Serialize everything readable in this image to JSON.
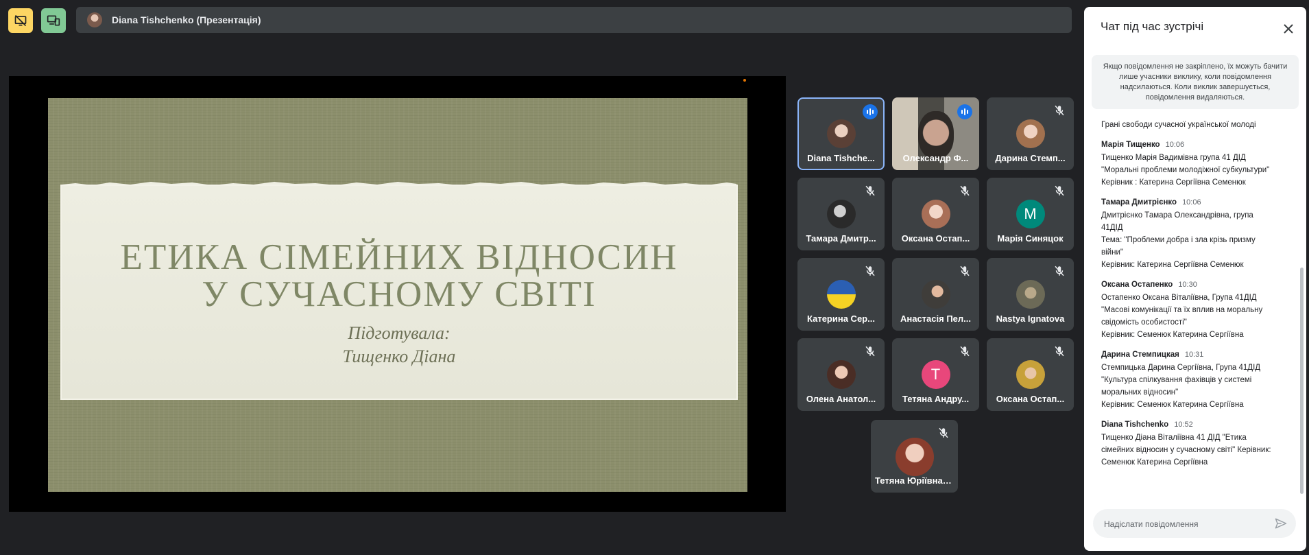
{
  "presenter": {
    "name": "Diana Tishchenko (Презентація)"
  },
  "slide": {
    "title_line1": "ЕТИКА СІМЕЙНИХ ВІДНОСИН",
    "title_line2": "У СУЧАСНОМУ СВІТІ",
    "subtitle_line1": "Підготувала:",
    "subtitle_line2": "Тищенко Діана"
  },
  "participants": [
    {
      "name": "Diana Tishche...",
      "state": "speaking",
      "avatar": "photo"
    },
    {
      "name": "Олександр Ф...",
      "state": "speaking",
      "avatar": "video"
    },
    {
      "name": "Дарина Стемп...",
      "state": "muted",
      "avatar": "photo"
    },
    {
      "name": "Тамара Дмитр...",
      "state": "muted",
      "avatar": "photo"
    },
    {
      "name": "Оксана Остап...",
      "state": "muted",
      "avatar": "photo"
    },
    {
      "name": "Марія Синяцок",
      "state": "muted",
      "avatar": "letter",
      "letter": "M",
      "color": "#00897b"
    },
    {
      "name": "Катерина Сер...",
      "state": "muted",
      "avatar": "photo"
    },
    {
      "name": "Анастасія Пел...",
      "state": "muted",
      "avatar": "photo"
    },
    {
      "name": "Nastya Ignatova",
      "state": "muted",
      "avatar": "photo"
    },
    {
      "name": "Олена Анатол...",
      "state": "muted",
      "avatar": "photo"
    },
    {
      "name": "Тетяна Андру...",
      "state": "muted",
      "avatar": "letter",
      "letter": "T",
      "color": "#e8477b"
    },
    {
      "name": "Оксана Остап...",
      "state": "muted",
      "avatar": "photo"
    },
    {
      "name": "Тетяна Юріївна Шульга",
      "state": "muted",
      "avatar": "photo"
    }
  ],
  "chat": {
    "title": "Чат під час зустрічі",
    "notice": "Якщо повідомлення не закріплено, їх можуть бачити лише учасники виклику, коли повідомлення надсилаються. Коли виклик завершується, повідомлення видаляються.",
    "first_line": "Грані свободи сучасної української молоді",
    "messages": [
      {
        "sender": "Марія Тищенко",
        "time": "10:06",
        "lines": [
          "Тищенко Марія Вадимівна група 41 ДІД",
          "\"Моральні проблеми молодіжної субкультури\"",
          "Керівник : Катерина Сергіївна Семенюк"
        ]
      },
      {
        "sender": "Тамара Дмитрієнко",
        "time": "10:06",
        "lines": [
          "Дмитрієнко Тамара Олександрівна, група",
          "41ДІД",
          "Тема: \"Проблеми добра і зла крізь призму",
          "війни\"",
          "Керівник: Катерина Сергіївна Семенюк"
        ]
      },
      {
        "sender": "Оксана Остапенко",
        "time": "10:30",
        "lines": [
          "Остапенко Оксана Віталіївна, Група 41ДІД",
          "\"Масові комунікації та їх вплив на моральну",
          "свідомість особистості\"",
          "Керівник: Семенюк Катерина Сергіївна"
        ]
      },
      {
        "sender": "Дарина Стемпицкая",
        "time": "10:31",
        "lines": [
          "Стемпицька Дарина Сергіївна, Група 41ДІД",
          "\"Культура спілкування фахівців у системі",
          "моральних відносин\"",
          "Керівник: Семенюк Катерина Сергіївна"
        ]
      },
      {
        "sender": "Diana Tishchenko",
        "time": "10:52",
        "lines": [
          "Тищенко Діана Віталіївна 41 ДІД \"Етика",
          "сімейних відносин у сучасному світі\" Керівник:",
          "Семенюк Катерина Сергіївна"
        ]
      }
    ],
    "input_placeholder": "Надіслати повідомлення"
  },
  "colors": {
    "present_button": "#fdd663",
    "devices_button": "#81c995",
    "active_tile": "#8ab4f8",
    "speaking": "#1a73e8"
  }
}
